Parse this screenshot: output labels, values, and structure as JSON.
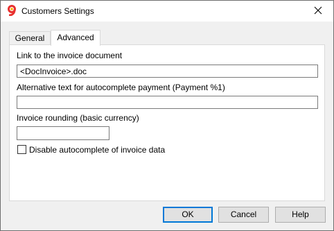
{
  "window": {
    "title": "Customers Settings"
  },
  "icons": {
    "app": "app-logo-icon",
    "close": "close-icon"
  },
  "tabs": [
    {
      "label": "General",
      "active": false
    },
    {
      "label": "Advanced",
      "active": true
    }
  ],
  "form": {
    "link_label": "Link to the invoice document",
    "link_value": "<DocInvoice>.doc",
    "alt_text_label": "Alternative text for autocomplete payment (Payment %1)",
    "alt_text_value": "",
    "rounding_label": "Invoice rounding (basic currency)",
    "rounding_value": "",
    "disable_autocomplete_label": "Disable autocomplete of invoice data",
    "disable_autocomplete_checked": false
  },
  "buttons": {
    "ok": "OK",
    "cancel": "Cancel",
    "help": "Help"
  },
  "colors": {
    "accent": "#0078d7",
    "logo_red": "#e8312f",
    "logo_yellow": "#f7b500"
  }
}
